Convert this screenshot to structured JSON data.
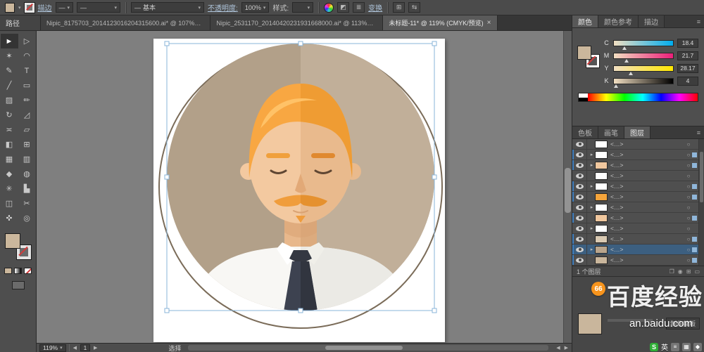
{
  "control_bar": {
    "path_label": "路径",
    "stroke_link": "描边",
    "brush_def": "基本",
    "opacity_label": "不透明度:",
    "opacity_value": "100%",
    "style_label": "样式:",
    "transform_link": "变换"
  },
  "icons": {
    "caret_down": "▾",
    "expand": "▸",
    "tri_left": "◀",
    "tri_right": "▶",
    "menu": "≡",
    "target": "○",
    "dash": "—",
    "grid": "⊞",
    "half": "◩",
    "lines": "≣",
    "swap": "⇆",
    "new_layer": "❐",
    "circle": "◉",
    "sheet": "▭"
  },
  "tabs": [
    {
      "label": "Nipic_8175703_2014123016204315600.ai* @ 107%…",
      "state": "",
      "close": ""
    },
    {
      "label": "Nipic_2531170_20140420231931668000.ai* @ 113%…",
      "state": "",
      "close": ""
    },
    {
      "label": "未标题-11* @ 119% (CMYK/预览)",
      "state": "active",
      "close": "×"
    }
  ],
  "tools": [
    {
      "name": "selection-tool",
      "glyph": "►",
      "cls": "tactive"
    },
    {
      "name": "direct-selection-tool",
      "glyph": "▷",
      "cls": ""
    },
    {
      "name": "magic-wand-tool",
      "glyph": "✶",
      "cls": ""
    },
    {
      "name": "lasso-tool",
      "glyph": "◠",
      "cls": ""
    },
    {
      "name": "pen-tool",
      "glyph": "✎",
      "cls": ""
    },
    {
      "name": "type-tool",
      "glyph": "T",
      "cls": ""
    },
    {
      "name": "line-segment-tool",
      "glyph": "╱",
      "cls": ""
    },
    {
      "name": "rectangle-tool",
      "glyph": "▭",
      "cls": ""
    },
    {
      "name": "paintbrush-tool",
      "glyph": "▨",
      "cls": ""
    },
    {
      "name": "pencil-tool",
      "glyph": "✏",
      "cls": ""
    },
    {
      "name": "rotate-tool",
      "glyph": "↻",
      "cls": ""
    },
    {
      "name": "scale-tool",
      "glyph": "◿",
      "cls": ""
    },
    {
      "name": "width-tool",
      "glyph": "≍",
      "cls": ""
    },
    {
      "name": "free-transform-tool",
      "glyph": "▱",
      "cls": ""
    },
    {
      "name": "shape-builder-tool",
      "glyph": "◧",
      "cls": ""
    },
    {
      "name": "perspective-grid-tool",
      "glyph": "⊞",
      "cls": ""
    },
    {
      "name": "mesh-tool",
      "glyph": "▦",
      "cls": ""
    },
    {
      "name": "gradient-tool",
      "glyph": "▥",
      "cls": ""
    },
    {
      "name": "eyedropper-tool",
      "glyph": "◆",
      "cls": ""
    },
    {
      "name": "blend-tool",
      "glyph": "◍",
      "cls": ""
    },
    {
      "name": "symbol-sprayer-tool",
      "glyph": "✳",
      "cls": ""
    },
    {
      "name": "column-graph-tool",
      "glyph": "▙",
      "cls": ""
    },
    {
      "name": "artboard-tool",
      "glyph": "◫",
      "cls": ""
    },
    {
      "name": "slice-tool",
      "glyph": "✂",
      "cls": ""
    },
    {
      "name": "hand-tool",
      "glyph": "✜",
      "cls": ""
    },
    {
      "name": "zoom-tool",
      "glyph": "◎",
      "cls": ""
    }
  ],
  "color_panel": {
    "tab_color": "颜色",
    "tab_guide": "颜色参考",
    "tab_stroke": "描边",
    "channels": [
      {
        "name": "cyan-channel",
        "label": "C",
        "value": "18.4",
        "color": "#00adef",
        "pos": "18%"
      },
      {
        "name": "magenta-channel",
        "label": "M",
        "value": "21.7",
        "color": "#ec1e79",
        "pos": "22%"
      },
      {
        "name": "yellow-channel",
        "label": "Y",
        "value": "28.17",
        "color": "#ffe800",
        "pos": "28%"
      },
      {
        "name": "black-channel",
        "label": "K",
        "value": "4",
        "color": "#000000",
        "pos": "4%"
      }
    ]
  },
  "panel_tabs": {
    "swatches": "色板",
    "brushes": "画笔",
    "layers": "图层"
  },
  "layers_panel": {
    "rows": [
      {
        "name": "<…>",
        "thumb": "#ffffff",
        "expand": "",
        "cls": ""
      },
      {
        "name": "<…>",
        "thumb": "#ffffff",
        "expand": "▸",
        "cls": "rsel"
      },
      {
        "name": "<…>",
        "thumb": "#f0c79e",
        "expand": "▸",
        "cls": "rsel"
      },
      {
        "name": "<…>",
        "thumb": "#ffffff",
        "expand": "",
        "cls": ""
      },
      {
        "name": "<…>",
        "thumb": "#ffffff",
        "expand": "▸",
        "cls": "rsel"
      },
      {
        "name": "<…>",
        "thumb": "#f6a53b",
        "expand": "",
        "cls": "rsel"
      },
      {
        "name": "<…>",
        "thumb": "#ffffff",
        "expand": "▸",
        "cls": ""
      },
      {
        "name": "<…>",
        "thumb": "#f0c79e",
        "expand": "",
        "cls": "rsel"
      },
      {
        "name": "<…>",
        "thumb": "#ffffff",
        "expand": "▸",
        "cls": ""
      },
      {
        "name": "<…>",
        "thumb": "#d9c9b2",
        "expand": "",
        "cls": "rsel"
      },
      {
        "name": "<…>",
        "thumb": "#b9a58d",
        "expand": "▸",
        "cls": "ractive"
      },
      {
        "name": "<…>",
        "thumb": "#c9b69c",
        "expand": "",
        "cls": "rsel"
      }
    ],
    "status": "1 个图层"
  },
  "bottom_panel": {
    "make_mask": "制作蒙版"
  },
  "status_bar": {
    "zoom": "119%",
    "artboard": "1",
    "tool_hint": "选择"
  },
  "watermark": {
    "badge": "66",
    "brand": "百度经验",
    "url": "an.baidu.com"
  },
  "ime": [
    {
      "name": "sogou-logo-icon",
      "glyph": "S",
      "cls": "ime-sogou"
    },
    {
      "name": "ime-lang-indicator",
      "glyph": "英",
      "cls": "ime-lang"
    },
    {
      "name": "ime-menu-icon",
      "glyph": "≡",
      "cls": "ime-chip"
    },
    {
      "name": "ime-keyboard-icon",
      "glyph": "▦",
      "cls": "ime-chip"
    },
    {
      "name": "ime-toolbox-icon",
      "glyph": "◆",
      "cls": "ime-chip"
    }
  ],
  "palette": {
    "fill_swatch": "#cbb79c",
    "bg_left": "#b2a089",
    "bg_right": "#c1af99",
    "skin": "#f3c9a0",
    "skin_shade": "#e9ba8d",
    "hair": "#f8a742",
    "hair_shade": "#ef9c33",
    "brow": "#f0a03c",
    "shirt": "#f8f7f4",
    "shirt_shade": "#ebeae5",
    "tie": "#3d4250",
    "tie_dark": "#343842",
    "neck": "#e8b88c",
    "neck_shade": "#dcab7e",
    "outline": "#7b6c59",
    "sel_blue": "#8ab4d8",
    "thumb_tan": "#c9b69c"
  }
}
